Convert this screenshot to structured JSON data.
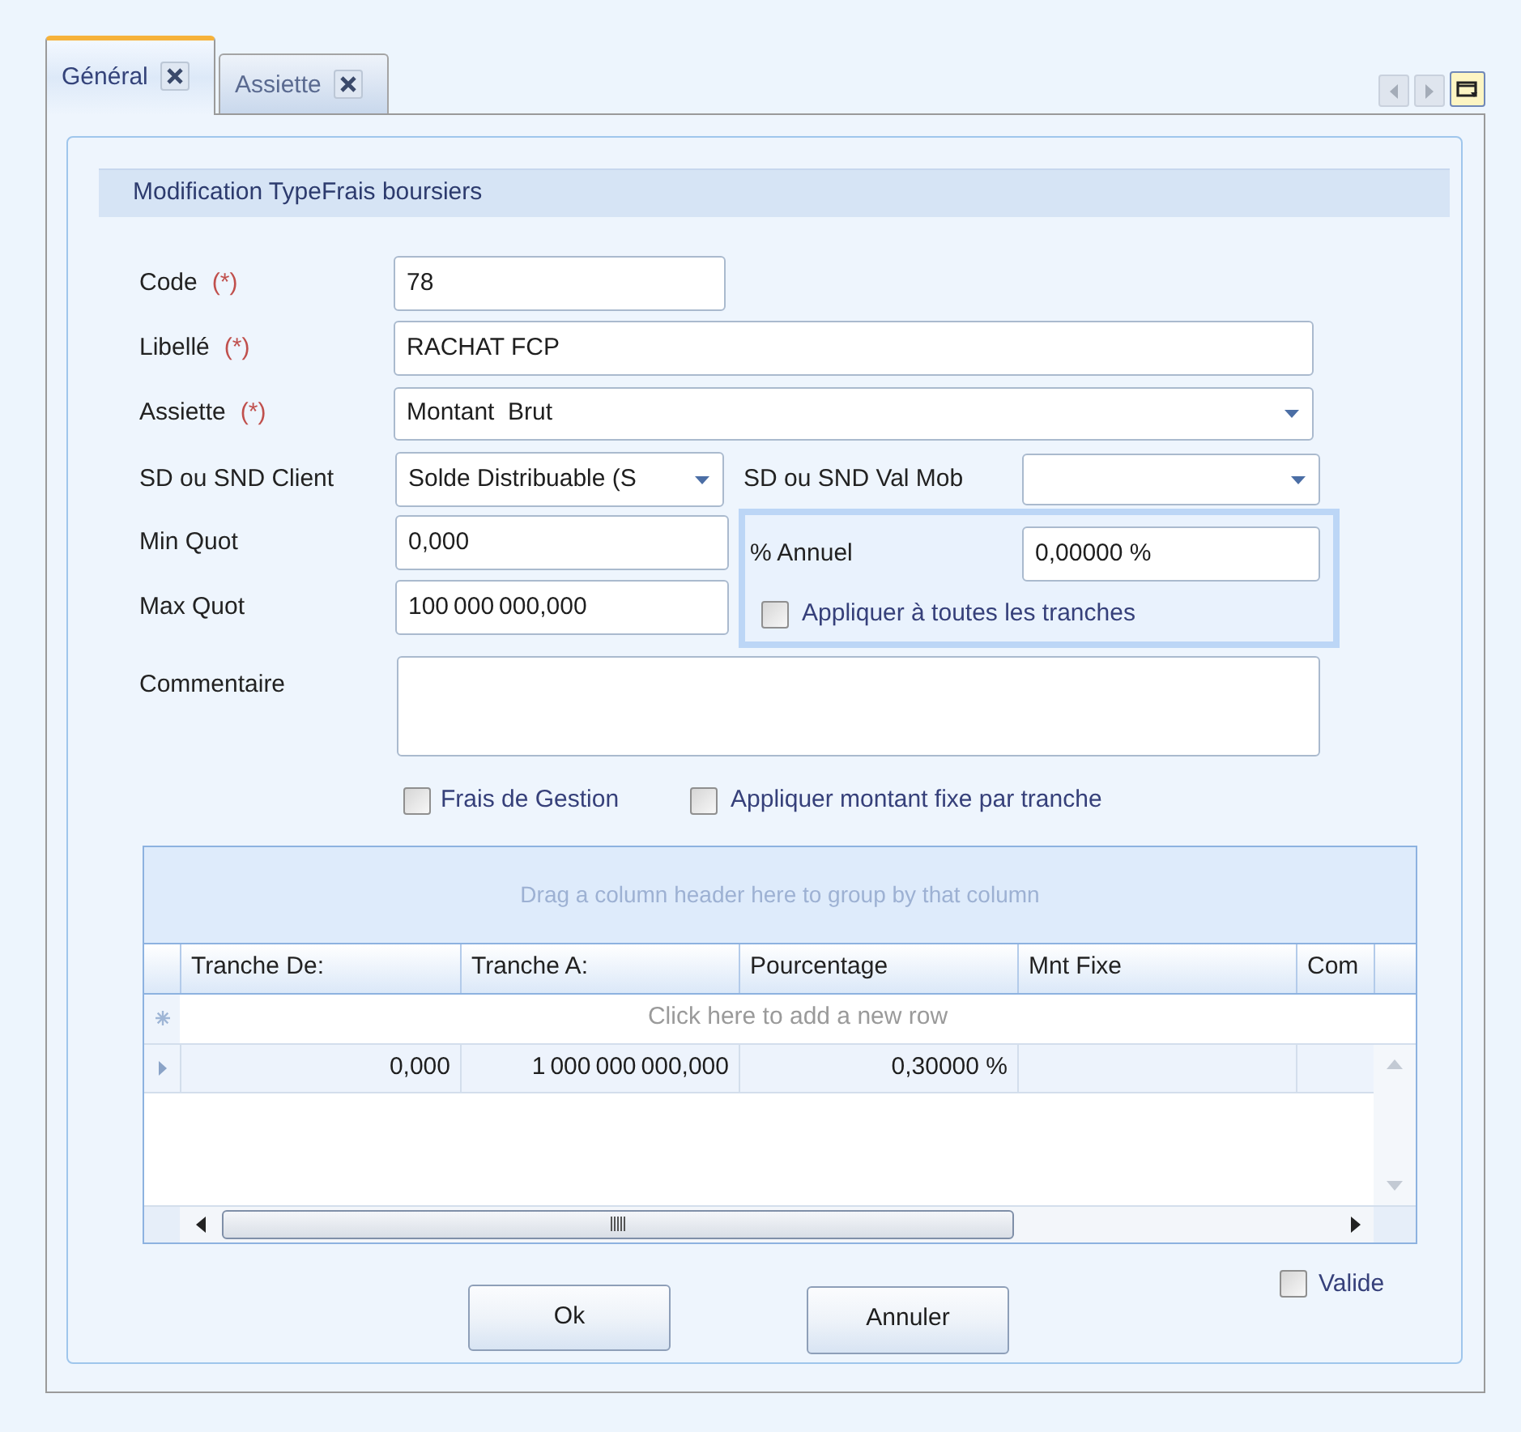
{
  "tabs": [
    {
      "label": "Général",
      "selected": true
    },
    {
      "label": "Assiette",
      "selected": false
    }
  ],
  "section": {
    "title": "Modification TypeFrais boursiers"
  },
  "form": {
    "code": {
      "label": "Code",
      "required_mark": "(*)",
      "value": "78"
    },
    "libelle": {
      "label": "Libellé",
      "required_mark": "(*)",
      "value": "RACHAT FCP"
    },
    "assiette": {
      "label": "Assiette",
      "required_mark": "(*)",
      "value": "Montant  Brut"
    },
    "sd_client": {
      "label": "SD ou SND Client",
      "value": "Solde Distribuable (S"
    },
    "sd_val_mob": {
      "label": "SD ou SND Val Mob"
    },
    "min_quot": {
      "label": "Min Quot",
      "value": "0,000"
    },
    "max_quot": {
      "label": "Max Quot",
      "value": "100 000 000,000"
    },
    "annuel": {
      "label": "% Annuel",
      "value": "0,00000 %"
    },
    "apply_all": {
      "label": "Appliquer à toutes les tranches",
      "checked": false
    },
    "commentaire": {
      "label": "Commentaire"
    },
    "options": [
      {
        "label": "Frais de Gestion",
        "checked": false
      },
      {
        "label": "Appliquer montant fixe par tranche",
        "checked": false
      }
    ]
  },
  "grid": {
    "group_hint": "Drag a column header here to group by that column",
    "columns": [
      "Tranche De:",
      "Tranche A:",
      "Pourcentage",
      "Mnt Fixe",
      "Com"
    ],
    "new_row_hint": "Click here to add a new row",
    "rows": [
      {
        "selected": true,
        "cells": [
          "0,000",
          "1 000 000 000,000",
          "0,30000 %"
        ]
      }
    ]
  },
  "valide": {
    "label": "Valide",
    "checked": false
  },
  "buttons": [
    "Ok",
    "Annuler"
  ]
}
